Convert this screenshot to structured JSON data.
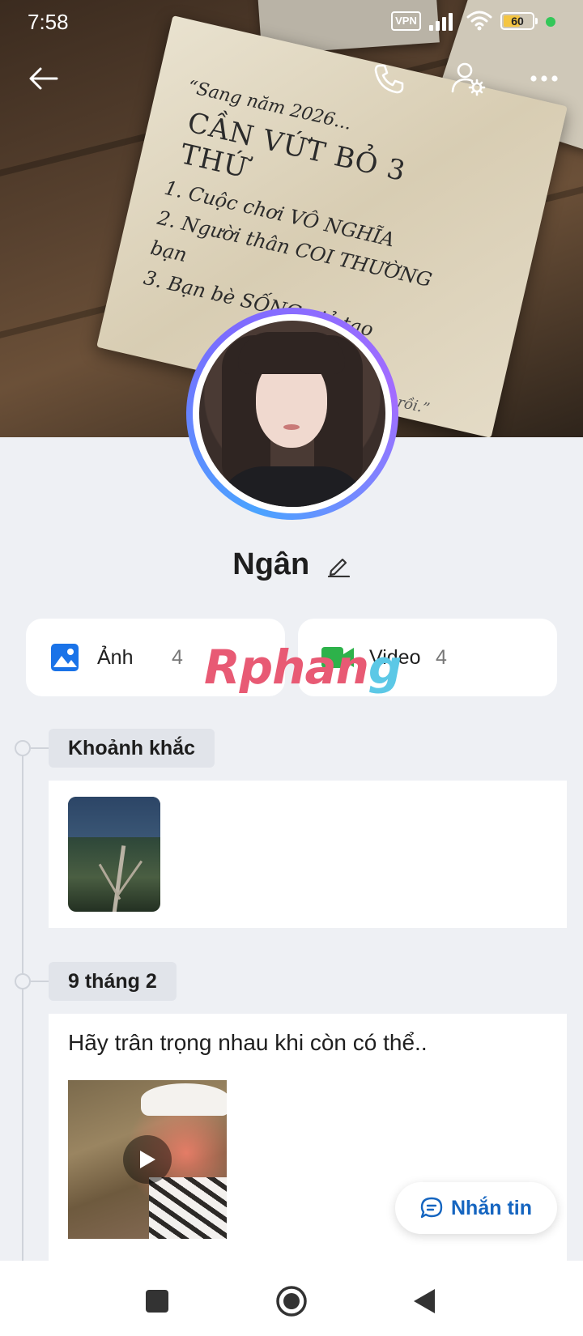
{
  "status_bar": {
    "time": "7:58",
    "vpn_label": "VPN",
    "battery_level": "60",
    "battery_fraction": 0.6
  },
  "cover": {
    "note_lines": [
      "“Sang năm 2026...",
      "CẦN VỨT BỎ 3 THỨ",
      "1. Cuộc chơi VÔ NGHĨA",
      "2. Người thân COI THƯỜNG bạn",
      "3. Bạn bè SỐNG giả tạo",
      "đủ rồi.”"
    ]
  },
  "top_nav": {
    "back_icon": "arrow-left-icon",
    "call_icon": "phone-icon",
    "settings_icon": "user-settings-icon",
    "more_icon": "more-horizontal-icon"
  },
  "profile": {
    "name": "Ngân"
  },
  "media": {
    "photos": {
      "label": "Ảnh",
      "count": "4",
      "icon": "image-icon",
      "color": "#1a73e8"
    },
    "videos": {
      "label": "Video",
      "count": "4",
      "icon": "video-icon",
      "color": "#2db24a"
    }
  },
  "watermark": {
    "part1": "Rphan",
    "part2": "g"
  },
  "timeline": {
    "sections": [
      {
        "label": "Khoảnh khắc"
      },
      {
        "label": "9 tháng 2",
        "post_text": "Hãy trân trọng nhau khi còn có thể.."
      }
    ]
  },
  "message_button": {
    "label": "Nhắn tin"
  },
  "colors": {
    "accent": "#1565c0",
    "background": "#eef0f4"
  }
}
